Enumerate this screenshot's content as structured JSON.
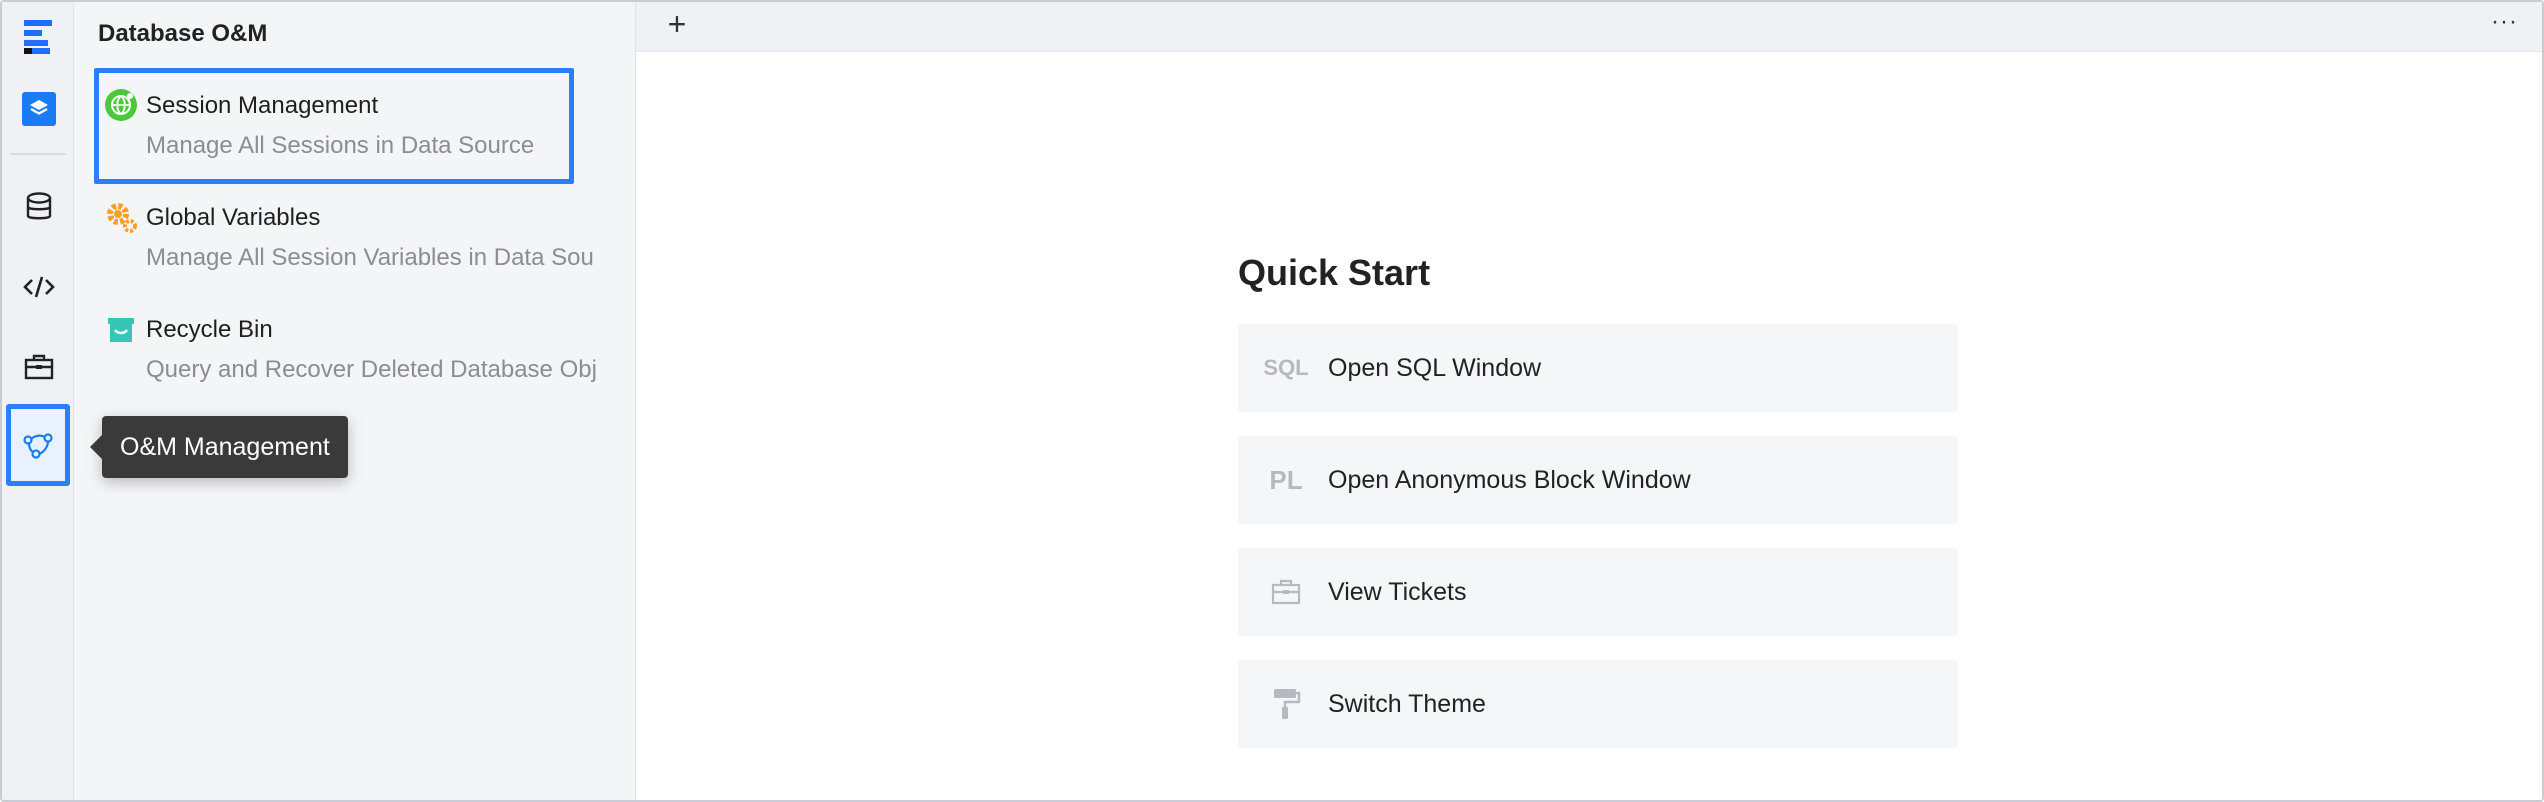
{
  "explorer": {
    "title": "Database O&M",
    "items": [
      {
        "title": "Session Management",
        "desc": "Manage All Sessions in Data Source",
        "icon": "session-globe-icon",
        "color": "#4cc93a"
      },
      {
        "title": "Global Variables",
        "desc": "Manage All Session Variables in Data Sou",
        "icon": "gear-variables-icon",
        "color": "#ff9d2a"
      },
      {
        "title": "Recycle Bin",
        "desc": "Query and Recover Deleted Database Obj",
        "icon": "recycle-bin-icon",
        "color": "#35c6b8"
      }
    ]
  },
  "activity_bar": {
    "items": [
      "app-logo-icon",
      "layers-icon",
      "database-icon",
      "code-icon",
      "tickets-briefcase-icon",
      "om-management-icon"
    ],
    "selected": "om-management-icon",
    "accent": "#2b7fff"
  },
  "tooltip": {
    "text": "O&M Management"
  },
  "tabbar": {
    "add_label": "+",
    "more_label": "···"
  },
  "quick_start": {
    "title": "Quick Start",
    "items": [
      {
        "label": "Open SQL Window",
        "icon_text": "SQL",
        "icon": "sql-icon"
      },
      {
        "label": "Open Anonymous Block Window",
        "icon_text": "PL",
        "icon": "pl-icon"
      },
      {
        "label": "View Tickets",
        "icon": "tickets-icon"
      },
      {
        "label": "Switch Theme",
        "icon": "paint-roller-icon"
      }
    ]
  }
}
